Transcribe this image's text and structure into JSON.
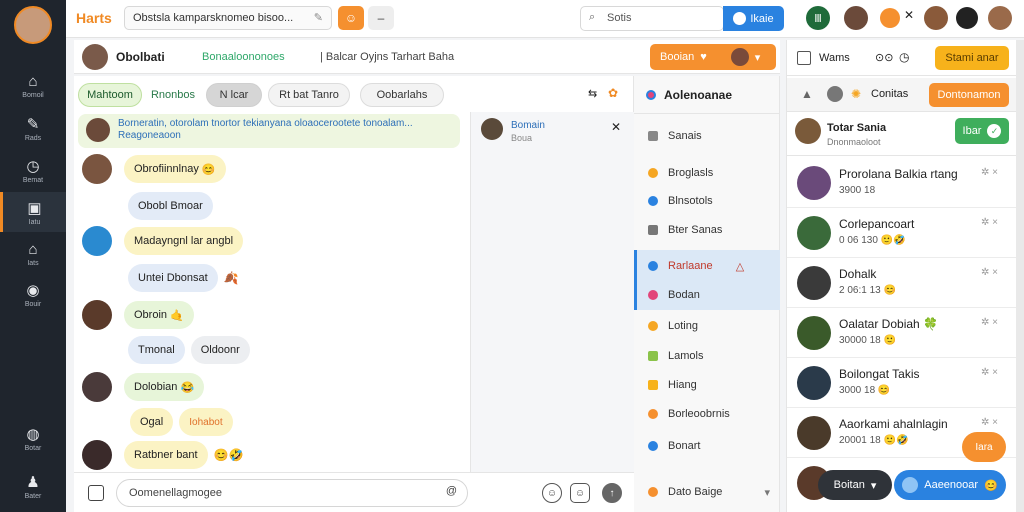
{
  "app": {
    "brand": "Harts"
  },
  "topbar": {
    "search_value": "Obstsla kamparsknomeo bisoo...",
    "search2_placeholder": "Sotis",
    "search_button": "Ikaie"
  },
  "rail": [
    {
      "icon": "home-icon",
      "label": "Bomoil"
    },
    {
      "icon": "tag-icon",
      "label": "Rads"
    },
    {
      "icon": "clock-icon",
      "label": "Bemat"
    },
    {
      "icon": "note-icon",
      "label": "Iatu"
    },
    {
      "icon": "house-icon",
      "label": "Iats"
    },
    {
      "icon": "camera-icon",
      "label": "Bouir"
    },
    {
      "icon": "chat-icon",
      "label": "Botar"
    },
    {
      "icon": "user-icon",
      "label": "Bater"
    }
  ],
  "chat_header": {
    "title": "Obolbati",
    "subtitle": "Bonaaloononoes",
    "subtitle2": "| Balcar Oyjns Tarhart Baha",
    "status_button": "Booian"
  },
  "filters": [
    "Mahtoom",
    "Rnonbos",
    "N lcar",
    "Rt bat Tanro",
    "Oobarlahs"
  ],
  "notice": {
    "line1": "Borneratin, otorolam tnortor tekianyana oloaocerootete tonoalam...",
    "line2": "Reagoneaoon"
  },
  "thread": {
    "title": "Bomain",
    "sub": "Boua"
  },
  "messages": [
    {
      "text": "Obrofiinnlnay",
      "emoji": "😊"
    },
    {
      "text": "Obobl Bmoar",
      "emoji": ""
    },
    {
      "text": "Madayngnl lar angbl",
      "emoji": ""
    },
    {
      "text": "Untei Dbonsat",
      "emoji": "🍂"
    },
    {
      "text": "Obroin",
      "emoji": "🤙"
    },
    {
      "text": "Tmonal",
      "emoji": ""
    },
    {
      "text": "Oldoonr",
      "emoji": ""
    },
    {
      "text": "Dolobian",
      "emoji": "😂"
    },
    {
      "text": "Ogal",
      "emoji": ""
    },
    {
      "text": "Iohabot",
      "emoji": ""
    },
    {
      "text": "Ratbner bant",
      "emoji": "😊🤣"
    }
  ],
  "composer": {
    "placeholder": "Oomenellagmogee"
  },
  "channels": {
    "header": "Aolenoanae",
    "items": [
      {
        "label": "Sanais",
        "selected": false,
        "color": "#888888"
      },
      {
        "label": "Broglasls",
        "selected": false,
        "color": "#f5a623"
      },
      {
        "label": "Blnsotols",
        "selected": false,
        "color": "#2a82e0"
      },
      {
        "label": "Bter Sanas",
        "selected": false,
        "color": "#777777"
      },
      {
        "label": "Rarlaane",
        "selected": true,
        "color": "#2a82e0"
      },
      {
        "label": "Bodan",
        "selected": false,
        "color": "#e2457a"
      },
      {
        "label": "Loting",
        "selected": false,
        "color": "#f5a623"
      },
      {
        "label": "Lamols",
        "selected": false,
        "color": "#8bc34a"
      },
      {
        "label": "Hiang",
        "selected": false,
        "color": "#f7b21b"
      },
      {
        "label": "Borleoobrnis",
        "selected": false,
        "color": "#f5902f"
      },
      {
        "label": "Bonart",
        "selected": false,
        "color": "#2a82e0"
      },
      {
        "label": "Dato Baige",
        "selected": false,
        "color": "#f5902f"
      }
    ]
  },
  "right": {
    "top_label": "Wams",
    "top_button": "Stami anar",
    "section_label": "Conitas",
    "section_button": "Dontonamon",
    "user_name": "Totar Sania",
    "user_sub": "Dnonmaoloot",
    "user_button": "Ibar",
    "contacts": [
      {
        "name": "Prorolana Balkia rtang",
        "status": "3900 18"
      },
      {
        "name": "Corlepancoart",
        "status": "0 06 130 🙂🤣"
      },
      {
        "name": "Dohalk",
        "status": "2 06:1 13 😊"
      },
      {
        "name": "Oalatar Dobiah 🍀",
        "status": "30000 18 🙂"
      },
      {
        "name": "Boilongat Takis",
        "status": "3000 18 😊"
      },
      {
        "name": "Aaorkami ahalnlagin",
        "status": "20001 18 🙂🤣"
      },
      {
        "name": "Boiton",
        "status": ""
      }
    ],
    "float_badge": "Iara",
    "float_button": "Aaeenooar",
    "float_dark": "Boitan"
  },
  "colors": {
    "accent": "#f08a24",
    "blue": "#2a82e0",
    "green": "#3fae5c",
    "rail": "#1f252d"
  }
}
